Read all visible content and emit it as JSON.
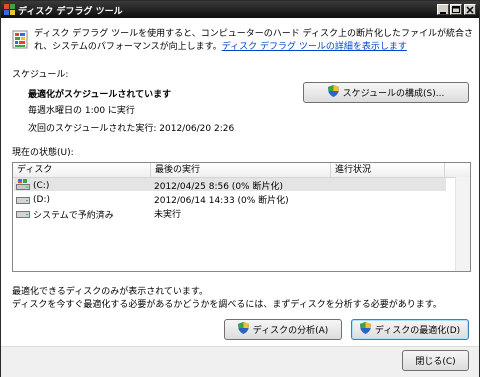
{
  "window": {
    "title": "ディスク デフラグ ツール"
  },
  "intro": {
    "text": "ディスク デフラグ ツールを使用すると、コンピューターのハード ディスク上の断片化したファイルが統合され、システムのパフォーマンスが向上します。",
    "link": "ディスク デフラグ ツールの詳細を表示します"
  },
  "schedule": {
    "heading": "スケジュール:",
    "status": "最適化がスケジュールされています",
    "frequency": "毎週水曜日の 1:00 に実行",
    "next_run": "次回のスケジュールされた実行: 2012/06/20 2:26",
    "configure_button": "スケジュールの構成(S)..."
  },
  "current_status": {
    "heading": "現在の状態(U):",
    "columns": [
      "ディスク",
      "最後の実行",
      "進行状況"
    ],
    "rows": [
      {
        "disk": "(C:)",
        "last_run": "2012/04/25 8:56 (0% 断片化)",
        "progress": "",
        "icon": "system-drive-icon"
      },
      {
        "disk": "(D:)",
        "last_run": "2012/06/14 14:33 (0% 断片化)",
        "progress": "",
        "icon": "drive-icon"
      },
      {
        "disk": "システムで予約済み",
        "last_run": "未実行",
        "progress": "",
        "icon": "drive-icon"
      }
    ]
  },
  "footer_note": {
    "line1": "最適化できるディスクのみが表示されています。",
    "line2": "ディスクを今すぐ最適化する必要があるかどうかを調べるには、まずディスクを分析する必要があります。"
  },
  "actions": {
    "analyze_button": "ディスクの分析(A)",
    "defragment_button": "ディスクの最適化(D)",
    "close_button": "閉じる(C)"
  },
  "colors": {
    "link": "#0044cc",
    "titlebar": "#1a1a1a",
    "selection": "#e4e4e4"
  }
}
